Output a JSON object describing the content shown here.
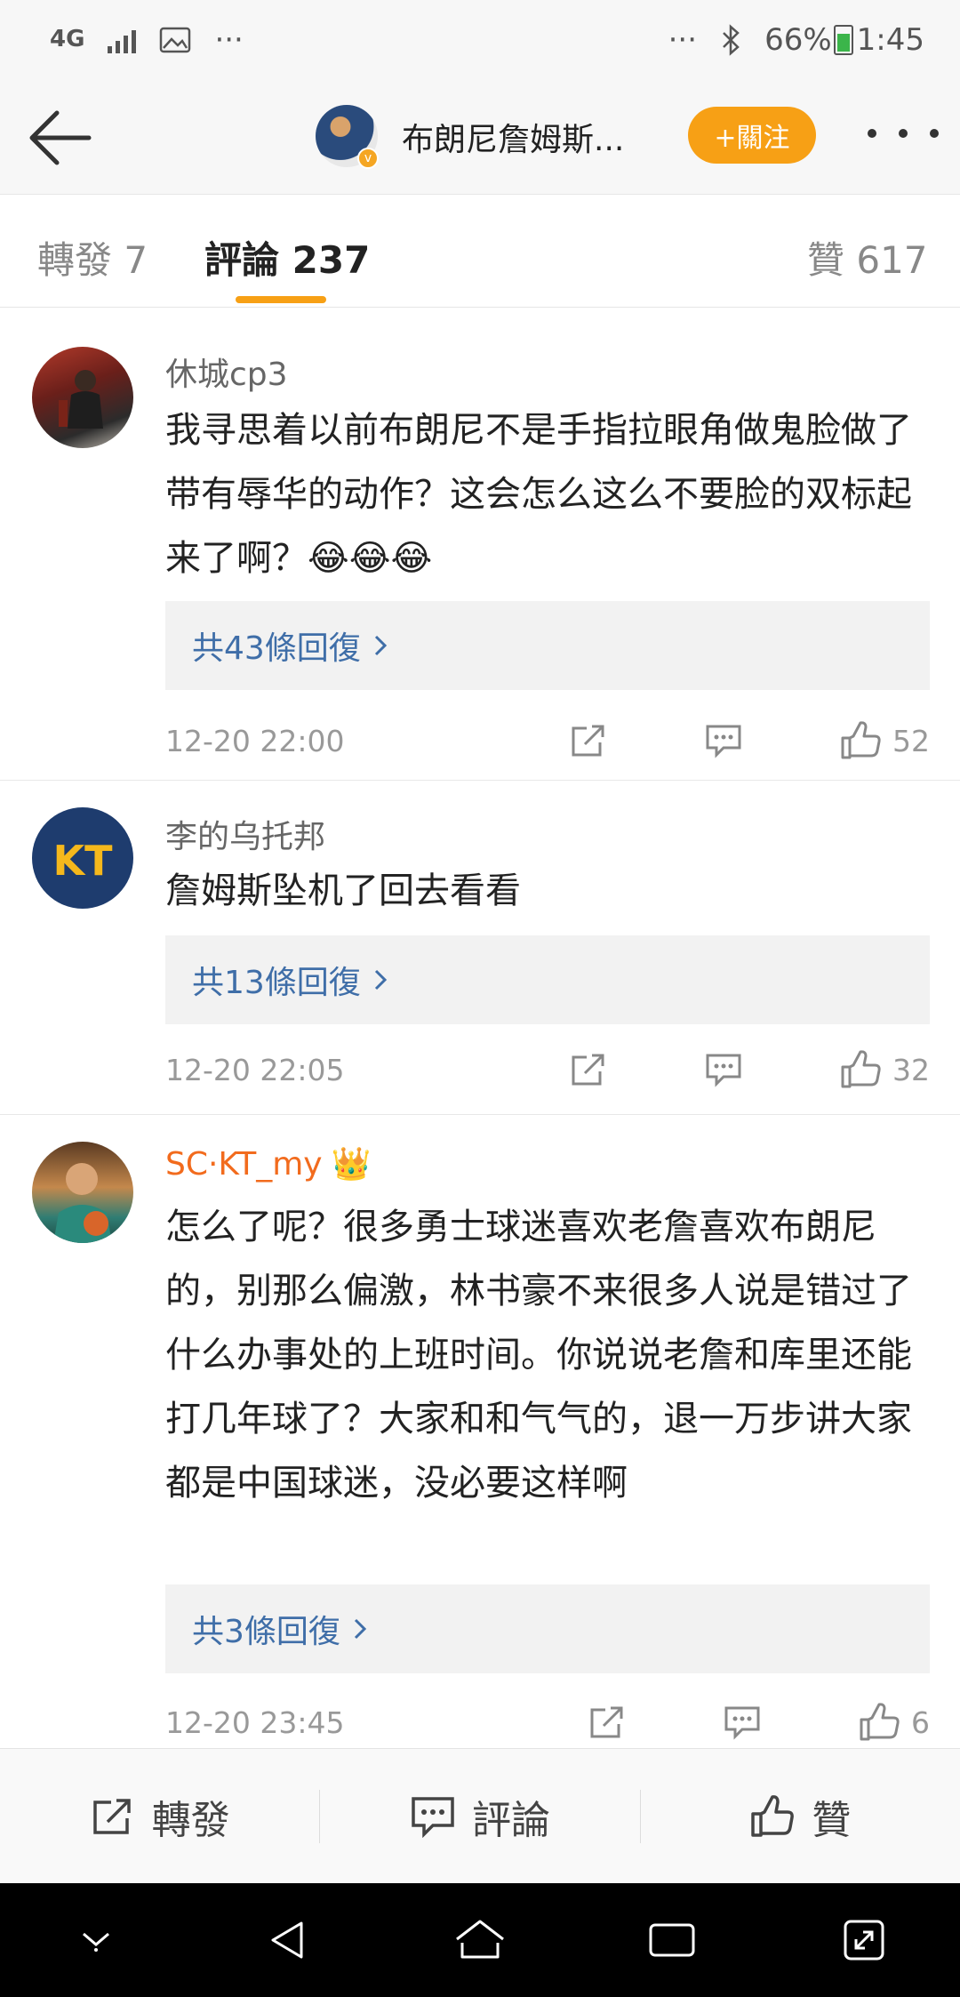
{
  "status_bar": {
    "network": "4G",
    "more_left": "···",
    "more_right": "···",
    "battery": "66%",
    "time": "1:45"
  },
  "header": {
    "title": "布朗尼詹姆斯...",
    "follow_label": "+關注",
    "verified_badge": "v"
  },
  "tabs": [
    {
      "label": "轉發 7"
    },
    {
      "label": "評論 237"
    },
    {
      "label": "贊 617"
    }
  ],
  "comments": [
    {
      "user": "休城cp3",
      "text": "我寻思着以前布朗尼不是手指拉眼角做鬼脸做了带有辱华的动作？这会怎么这么不要脸的双标起来了啊？😂😂😂",
      "replies": "共43條回復",
      "time": "12-20 22:00",
      "likes": "52"
    },
    {
      "user": "李的乌托邦",
      "text": "詹姆斯坠机了回去看看",
      "replies": "共13條回復",
      "time": "12-20 22:05",
      "likes": "32"
    },
    {
      "user": "SC·KT_my",
      "user_badge": "👑",
      "text": "怎么了呢？很多勇士球迷喜欢老詹喜欢布朗尼的，别那么偏激，林书豪不来很多人说是错过了什么办事处的上班时间。你说说老詹和库里还能打几年球了？大家和和气气的，退一万步讲大家都是中国球迷，没必要这样啊",
      "replies": "共3條回復",
      "time": "12-20 23:45",
      "likes": "6"
    }
  ],
  "avatar_text": {
    "kt_logo": "KT"
  },
  "bottom_bar": {
    "repost": "轉發",
    "comment": "評論",
    "like": "贊"
  },
  "colors": {
    "accent": "#f7a015",
    "link": "#3f6ea8",
    "vip_name": "#f26b1d"
  },
  "icons": [
    "back-arrow-icon",
    "more-dots-icon",
    "share-icon",
    "comment-icon",
    "like-icon",
    "chevron-right-icon"
  ]
}
